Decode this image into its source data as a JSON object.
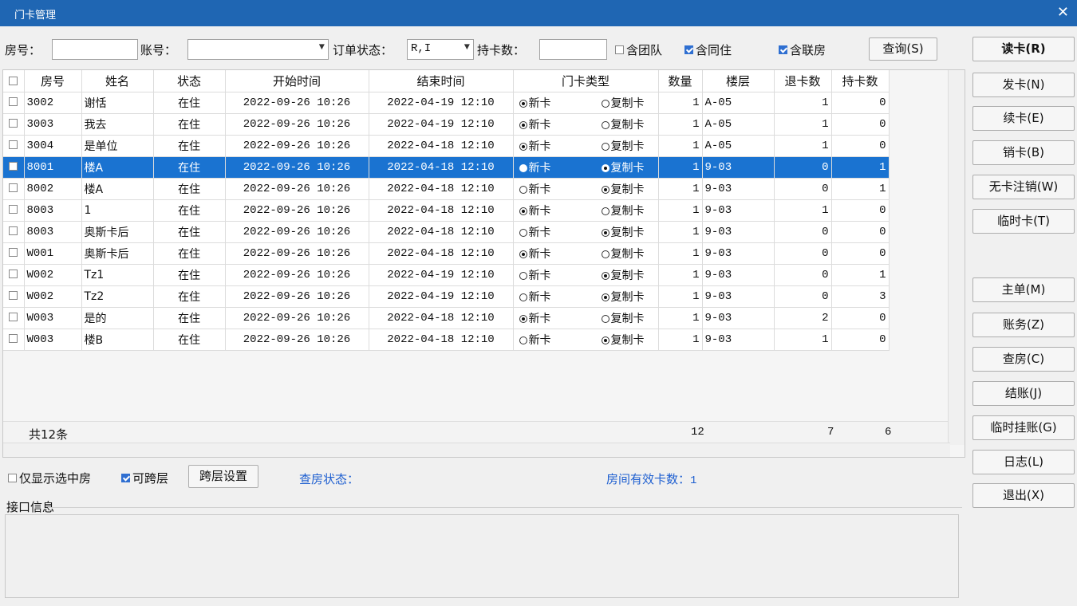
{
  "window": {
    "title": "门卡管理",
    "close_label": "✕"
  },
  "filters": {
    "room_label": "房号：",
    "room_value": "",
    "account_label": "账号：",
    "account_value": "",
    "order_status_label": "订单状态：",
    "order_status_value": "R,I",
    "card_count_label": "持卡数：",
    "card_count_value": "",
    "include_team": {
      "label": "含团队",
      "checked": false
    },
    "include_cohabit": {
      "label": "含同住",
      "checked": true
    },
    "include_linked": {
      "label": "含联房",
      "checked": true
    },
    "query_button": "查询(S)"
  },
  "table": {
    "columns": [
      "房号",
      "姓名",
      "状态",
      "开始时间",
      "结束时间",
      "门卡类型",
      "数量",
      "楼层",
      "退卡数",
      "持卡数"
    ],
    "radio_labels": {
      "new": "新卡",
      "copy": "复制卡"
    },
    "rows": [
      {
        "room": "3002",
        "name": "谢恬",
        "status": "在住",
        "start": "2022-09-26 10:26",
        "end": "2022-04-19 12:10",
        "card_type": "new",
        "qty": "1",
        "floor": "A-05",
        "returned": "1",
        "held": "0"
      },
      {
        "room": "3003",
        "name": "我去",
        "status": "在住",
        "start": "2022-09-26 10:26",
        "end": "2022-04-19 12:10",
        "card_type": "new",
        "qty": "1",
        "floor": "A-05",
        "returned": "1",
        "held": "0"
      },
      {
        "room": "3004",
        "name": "是单位",
        "status": "在住",
        "start": "2022-09-26 10:26",
        "end": "2022-04-18 12:10",
        "card_type": "new",
        "qty": "1",
        "floor": "A-05",
        "returned": "1",
        "held": "0"
      },
      {
        "room": "8001",
        "name": "楼A",
        "status": "在住",
        "start": "2022-09-26 10:26",
        "end": "2022-04-18 12:10",
        "card_type": "copy",
        "qty": "1",
        "floor": "9-03",
        "returned": "0",
        "held": "1",
        "selected": true
      },
      {
        "room": "8002",
        "name": "楼A",
        "status": "在住",
        "start": "2022-09-26 10:26",
        "end": "2022-04-18 12:10",
        "card_type": "copy",
        "qty": "1",
        "floor": "9-03",
        "returned": "0",
        "held": "1"
      },
      {
        "room": "8003",
        "name": "1",
        "status": "在住",
        "start": "2022-09-26 10:26",
        "end": "2022-04-18 12:10",
        "card_type": "new",
        "qty": "1",
        "floor": "9-03",
        "returned": "1",
        "held": "0"
      },
      {
        "room": "8003",
        "name": "奥斯卡后",
        "status": "在住",
        "start": "2022-09-26 10:26",
        "end": "2022-04-18 12:10",
        "card_type": "copy",
        "qty": "1",
        "floor": "9-03",
        "returned": "0",
        "held": "0"
      },
      {
        "room": "W001",
        "name": "奥斯卡后",
        "status": "在住",
        "start": "2022-09-26 10:26",
        "end": "2022-04-18 12:10",
        "card_type": "new",
        "qty": "1",
        "floor": "9-03",
        "returned": "0",
        "held": "0"
      },
      {
        "room": "W002",
        "name": "Tz1",
        "status": "在住",
        "start": "2022-09-26 10:26",
        "end": "2022-04-19 12:10",
        "card_type": "copy",
        "qty": "1",
        "floor": "9-03",
        "returned": "0",
        "held": "1"
      },
      {
        "room": "W002",
        "name": "Tz2",
        "status": "在住",
        "start": "2022-09-26 10:26",
        "end": "2022-04-19 12:10",
        "card_type": "copy",
        "qty": "1",
        "floor": "9-03",
        "returned": "0",
        "held": "3"
      },
      {
        "room": "W003",
        "name": "是的",
        "status": "在住",
        "start": "2022-09-26 10:26",
        "end": "2022-04-18 12:10",
        "card_type": "new",
        "qty": "1",
        "floor": "9-03",
        "returned": "2",
        "held": "0"
      },
      {
        "room": "W003",
        "name": "楼B",
        "status": "在住",
        "start": "2022-09-26 10:26",
        "end": "2022-04-18 12:10",
        "card_type": "copy",
        "qty": "1",
        "floor": "9-03",
        "returned": "1",
        "held": "0"
      }
    ],
    "footer": {
      "count": "共12条",
      "qty_total": "12",
      "returned_total": "7",
      "held_total": "6"
    }
  },
  "bottom": {
    "only_selected": {
      "label": "仅显示选中房",
      "checked": false
    },
    "cross_floor": {
      "label": "可跨层",
      "checked": true
    },
    "cross_floor_settings": "跨层设置",
    "checkout_status_label": "查房状态：",
    "valid_cards_label": "房间有效卡数：",
    "valid_cards_value": "1",
    "interface_info_label": "接口信息"
  },
  "side_buttons": {
    "read": "读卡(R)",
    "issue": "发卡(N)",
    "renew": "续卡(E)",
    "cancel": "销卡(B)",
    "cardless_cancel": "无卡注销(W)",
    "temp_card": "临时卡(T)",
    "main_order": "主单(M)",
    "account": "账务(Z)",
    "room_check": "查房(C)",
    "checkout": "结账(J)",
    "temp_hang": "临时挂账(G)",
    "log": "日志(L)",
    "exit": "退出(X)"
  }
}
